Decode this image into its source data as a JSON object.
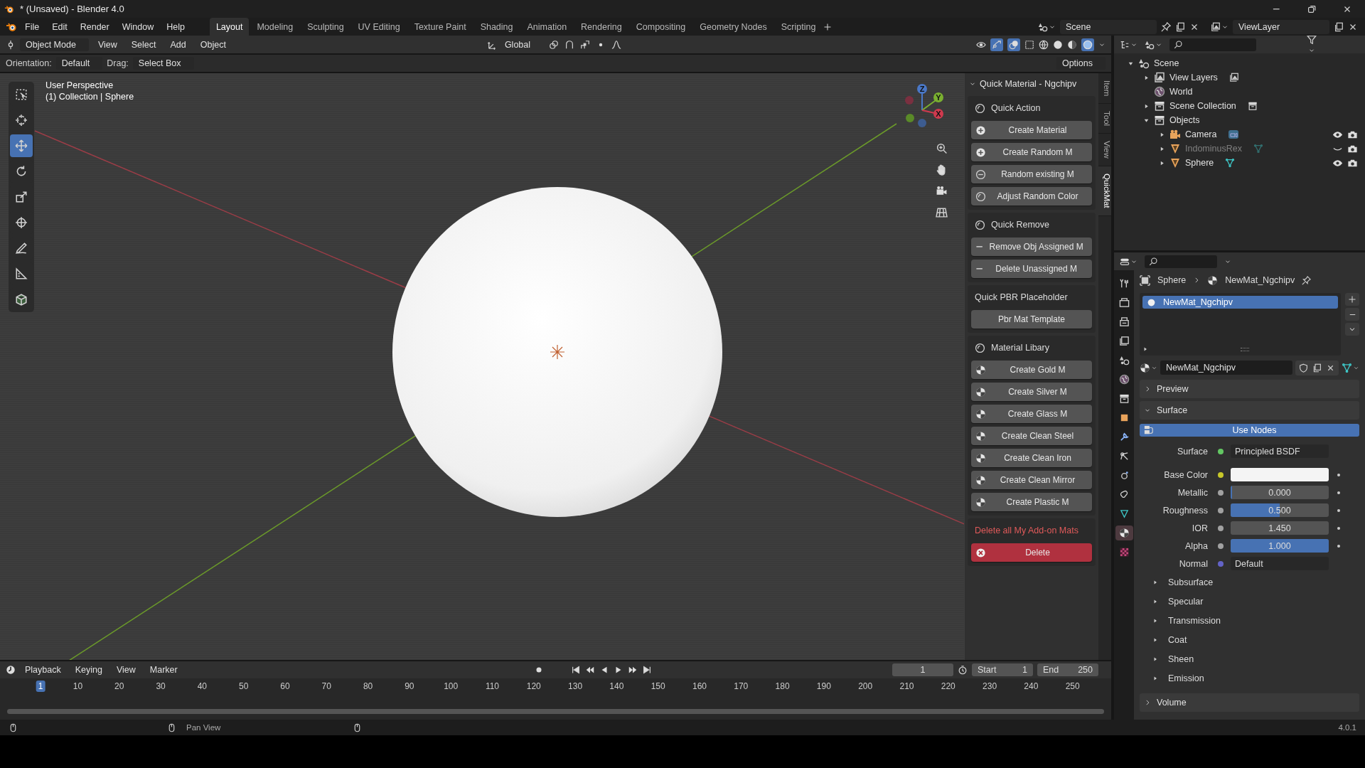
{
  "window": {
    "title": "* (Unsaved) - Blender 4.0"
  },
  "menu": [
    "File",
    "Edit",
    "Render",
    "Window",
    "Help"
  ],
  "workspaces": [
    {
      "label": "Layout",
      "selected": true
    },
    {
      "label": "Modeling",
      "selected": false
    },
    {
      "label": "Sculpting",
      "selected": false
    },
    {
      "label": "UV Editing",
      "selected": false
    },
    {
      "label": "Texture Paint",
      "selected": false
    },
    {
      "label": "Shading",
      "selected": false
    },
    {
      "label": "Animation",
      "selected": false
    },
    {
      "label": "Rendering",
      "selected": false
    },
    {
      "label": "Compositing",
      "selected": false
    },
    {
      "label": "Geometry Nodes",
      "selected": false
    },
    {
      "label": "Scripting",
      "selected": false
    }
  ],
  "scene_field": "Scene",
  "view_layer_field": "ViewLayer",
  "viewport_header": {
    "mode": "Object Mode",
    "menus": [
      "View",
      "Select",
      "Add",
      "Object"
    ],
    "orientation": "Global"
  },
  "tool_settings": {
    "orientation_label": "Orientation:",
    "orientation": "Default",
    "drag_label": "Drag:",
    "drag": "Select Box",
    "options": "Options"
  },
  "viewport": {
    "perspective": "User Perspective",
    "collection": "(1) Collection | Sphere",
    "gizmo_axes": [
      "Z",
      "Y",
      "X"
    ]
  },
  "tools": [
    {
      "kind": "select",
      "selected": false
    },
    {
      "kind": "cursor",
      "selected": false
    },
    {
      "kind": "move",
      "selected": true
    },
    {
      "kind": "rotate",
      "selected": false
    },
    {
      "kind": "scale",
      "selected": false
    },
    {
      "kind": "transform",
      "selected": false
    },
    {
      "kind": "annotate",
      "selected": false
    },
    {
      "kind": "measure",
      "selected": false
    },
    {
      "kind": "cube",
      "selected": false
    }
  ],
  "sidebar_tabs": [
    {
      "label": "Item",
      "selected": false
    },
    {
      "label": "Tool",
      "selected": false
    },
    {
      "label": "View",
      "selected": false
    },
    {
      "label": "QuickMat",
      "selected": true
    }
  ],
  "quick_material": {
    "title": "Quick Material - Ngchipv",
    "sections": [
      {
        "kind": "group",
        "heading": "Quick Action",
        "buttons": [
          {
            "label": "Create Material",
            "kind": "add"
          },
          {
            "label": "Create Random M",
            "kind": "add"
          },
          {
            "label": "Random existing M",
            "kind": "cycle"
          },
          {
            "label": "Adjust Random Color",
            "kind": "adjust"
          }
        ]
      },
      {
        "kind": "group",
        "heading": "Quick Remove",
        "buttons": [
          {
            "label": "Remove Obj Assigned M",
            "kind": "remove"
          },
          {
            "label": "Delete Unassigned M",
            "kind": "remove"
          }
        ]
      },
      {
        "kind": "plain",
        "heading": "Quick PBR Placeholder",
        "buttons": [
          {
            "label": "Pbr Mat Template",
            "kind": "plain"
          }
        ]
      },
      {
        "kind": "group",
        "heading": "Material Libary",
        "buttons": [
          {
            "label": "Create Gold M",
            "kind": "library"
          },
          {
            "label": "Create Silver M",
            "kind": "library"
          },
          {
            "label": "Create Glass M",
            "kind": "library"
          },
          {
            "label": "Create Clean Steel",
            "kind": "library"
          },
          {
            "label": "Create Clean Iron",
            "kind": "library"
          },
          {
            "label": "Create Clean Mirror",
            "kind": "library"
          },
          {
            "label": "Create Plastic M",
            "kind": "library"
          }
        ]
      },
      {
        "kind": "danger",
        "heading": "Delete all My Add-on Mats",
        "buttons": [
          {
            "label": "Delete",
            "kind": "danger"
          }
        ]
      }
    ]
  },
  "outliner": {
    "tree": [
      {
        "label": "Scene",
        "kind": "scene",
        "expanded": true,
        "children": [
          {
            "label": "View Layers",
            "kind": "view-layers",
            "expanded": false
          },
          {
            "label": "World",
            "kind": "world"
          },
          {
            "label": "Scene Collection",
            "kind": "collection",
            "expanded": false
          },
          {
            "label": "Objects",
            "kind": "collection",
            "expanded": true,
            "children": [
              {
                "label": "Camera",
                "kind": "camera",
                "expanded": false,
                "visible": true
              },
              {
                "label": "IndominusRex",
                "kind": "mesh",
                "expanded": false,
                "visible": false
              },
              {
                "label": "Sphere",
                "kind": "mesh",
                "expanded": false,
                "visible": true
              }
            ]
          }
        ]
      }
    ]
  },
  "properties": {
    "tabs": [
      {
        "kind": "tool",
        "selected": false
      },
      {
        "kind": "render",
        "selected": false
      },
      {
        "kind": "output",
        "selected": false
      },
      {
        "kind": "view-layer",
        "selected": false
      },
      {
        "kind": "scene",
        "selected": false
      },
      {
        "kind": "world",
        "selected": false
      },
      {
        "kind": "collection",
        "selected": false
      },
      {
        "kind": "object",
        "selected": false
      },
      {
        "kind": "modifier",
        "selected": false
      },
      {
        "kind": "particles",
        "selected": false
      },
      {
        "kind": "physics",
        "selected": false
      },
      {
        "kind": "constraints",
        "selected": false
      },
      {
        "kind": "data",
        "selected": false
      },
      {
        "kind": "material",
        "selected": true
      },
      {
        "kind": "texture",
        "selected": false
      }
    ],
    "breadcrumb": [
      "Sphere",
      "NewMat_Ngchipv"
    ],
    "slots": [
      {
        "name": "NewMat_Ngchipv",
        "selected": true
      }
    ],
    "material_name": "NewMat_Ngchipv",
    "preview": {
      "title": "Preview",
      "expanded": false
    },
    "surface": {
      "title": "Surface",
      "expanded": true,
      "use_nodes": "Use Nodes",
      "fields": [
        {
          "label": "Surface",
          "kind": "link",
          "value": "Principled BSDF",
          "color": "#63c763"
        },
        {
          "label": "Base Color",
          "kind": "swatch",
          "color": "#c7c729"
        },
        {
          "label": "Metallic",
          "kind": "slider",
          "value": "0.000",
          "level": 0,
          "color": "#a1a1a1"
        },
        {
          "label": "Roughness",
          "kind": "slider",
          "value": "0.500",
          "level": 0.5,
          "color": "#a1a1a1"
        },
        {
          "label": "IOR",
          "kind": "number",
          "value": "1.450",
          "color": "#a1a1a1"
        },
        {
          "label": "Alpha",
          "kind": "slider",
          "value": "1.000",
          "level": 1,
          "color": "#a1a1a1"
        },
        {
          "label": "Normal",
          "kind": "link",
          "value": "Default",
          "color": "#6363c7"
        }
      ],
      "subpanels": [
        {
          "title": "Subsurface",
          "expanded": false
        },
        {
          "title": "Specular",
          "expanded": false
        },
        {
          "title": "Transmission",
          "expanded": false
        },
        {
          "title": "Coat",
          "expanded": false
        },
        {
          "title": "Sheen",
          "expanded": false
        },
        {
          "title": "Emission",
          "expanded": false
        }
      ]
    },
    "volume": {
      "title": "Volume",
      "expanded": false
    }
  },
  "timeline": {
    "menus": [
      "Playback",
      "Keying",
      "View",
      "Marker"
    ],
    "current_frame": "1",
    "start_label": "Start",
    "start": "1",
    "end_label": "End",
    "end": "250",
    "ruler": [
      {
        "label": "1",
        "selected": true
      },
      {
        "label": "10",
        "selected": false
      },
      {
        "label": "20",
        "selected": false
      },
      {
        "label": "30",
        "selected": false
      },
      {
        "label": "40",
        "selected": false
      },
      {
        "label": "50",
        "selected": false
      },
      {
        "label": "60",
        "selected": false
      },
      {
        "label": "70",
        "selected": false
      },
      {
        "label": "80",
        "selected": false
      },
      {
        "label": "90",
        "selected": false
      },
      {
        "label": "100",
        "selected": false
      },
      {
        "label": "110",
        "selected": false
      },
      {
        "label": "120",
        "selected": false
      },
      {
        "label": "130",
        "selected": false
      },
      {
        "label": "140",
        "selected": false
      },
      {
        "label": "150",
        "selected": false
      },
      {
        "label": "160",
        "selected": false
      },
      {
        "label": "170",
        "selected": false
      },
      {
        "label": "180",
        "selected": false
      },
      {
        "label": "190",
        "selected": false
      },
      {
        "label": "200",
        "selected": false
      },
      {
        "label": "210",
        "selected": false
      },
      {
        "label": "220",
        "selected": false
      },
      {
        "label": "230",
        "selected": false
      },
      {
        "label": "240",
        "selected": false
      },
      {
        "label": "250",
        "selected": false
      }
    ]
  },
  "status_bar": {
    "hint": "Pan View",
    "version": "4.0.1"
  }
}
